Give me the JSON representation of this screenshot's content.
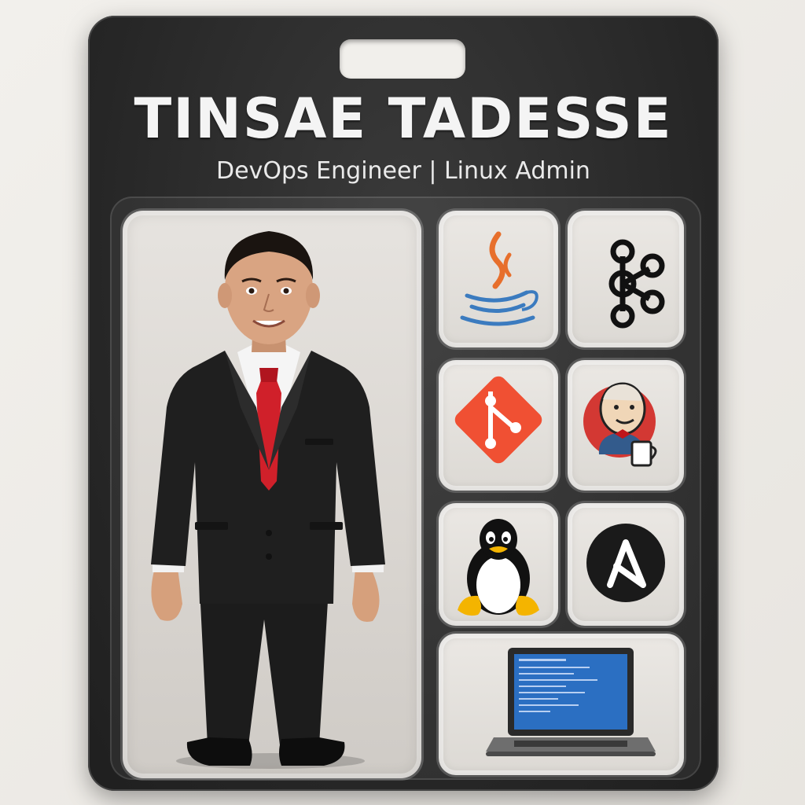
{
  "card": {
    "name": "TINSAE TADESSE",
    "role": "DevOps Engineer | Linux Admin"
  },
  "accessories": [
    {
      "icon": "java-icon"
    },
    {
      "icon": "kafka-icon"
    },
    {
      "icon": "git-icon"
    },
    {
      "icon": "jenkins-icon"
    },
    {
      "icon": "linux-tux-icon"
    },
    {
      "icon": "ansible-icon"
    },
    {
      "icon": "laptop-icon"
    }
  ],
  "colors": {
    "card_background": "#262626",
    "title_text": "#f4f4f4",
    "tie": "#d0202a",
    "git": "#f05033",
    "java_steam": "#e76f2c",
    "java_cup": "#3b7bbf",
    "ansible": "#1a1a1a",
    "laptop_screen": "#2b6fc2"
  }
}
